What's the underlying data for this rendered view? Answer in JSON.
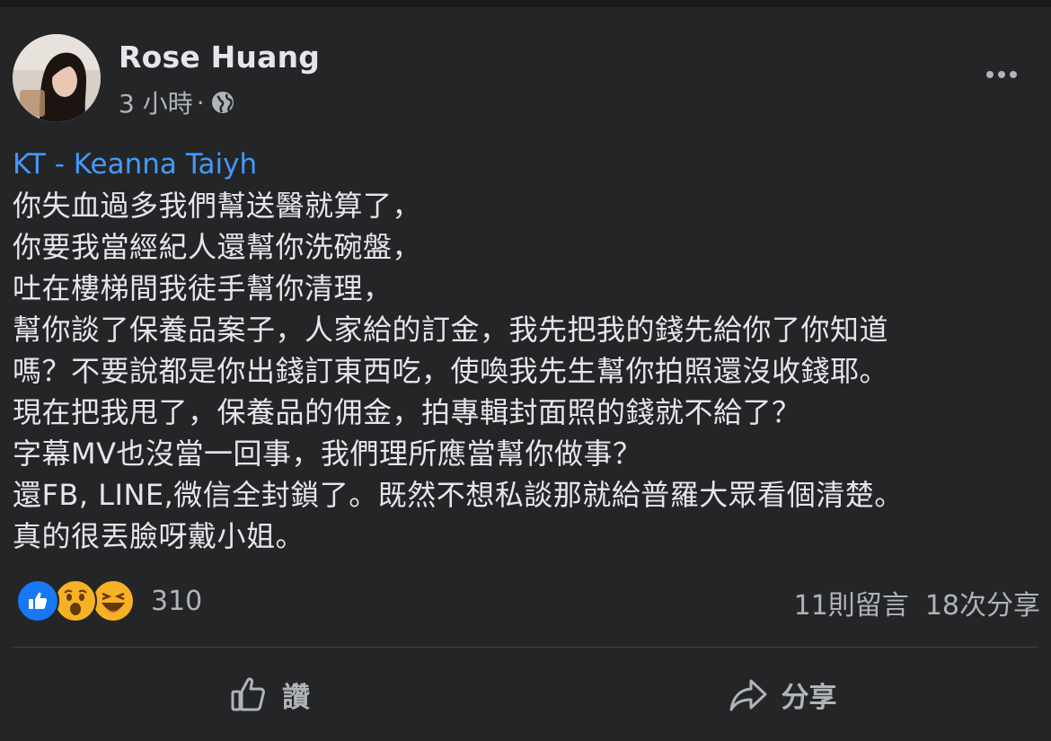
{
  "post": {
    "author": "Rose Huang",
    "timestamp": "3 小時",
    "separator": "·",
    "privacy_icon": "globe-icon",
    "mention": "KT - Keanna Taiyh",
    "lines": [
      "你失血過多我們幫送醫就算了，",
      "你要我當經紀人還幫你洗碗盤，",
      "吐在樓梯間我徒手幫你清理，",
      "幫你談了保養品案子，人家給的訂金，我先把我的錢先給你了你知道",
      "嗎？不要說都是你出錢訂東西吃，使喚我先生幫你拍照還沒收錢耶。",
      "現在把我甩了，保養品的佣金，拍專輯封面照的錢就不給了？",
      "字幕MV也沒當一回事，我們理所應當幫你做事？",
      "還FB, LINE,微信全封鎖了。既然不想私談那就給普羅大眾看個清楚。",
      "真的很丟臉呀戴小姐。"
    ]
  },
  "stats": {
    "reactions": [
      "like",
      "wow",
      "haha"
    ],
    "reaction_count": "310",
    "comments": "11則留言",
    "shares": "18次分享"
  },
  "actions": {
    "like_label": "讚",
    "share_label": "分享"
  },
  "colors": {
    "background": "#242526",
    "text": "#e4e6eb",
    "secondary": "#b0b3b8",
    "link": "#4599ff",
    "like_blue": "#1877f2",
    "emoji_yellow": "#f7b125"
  }
}
